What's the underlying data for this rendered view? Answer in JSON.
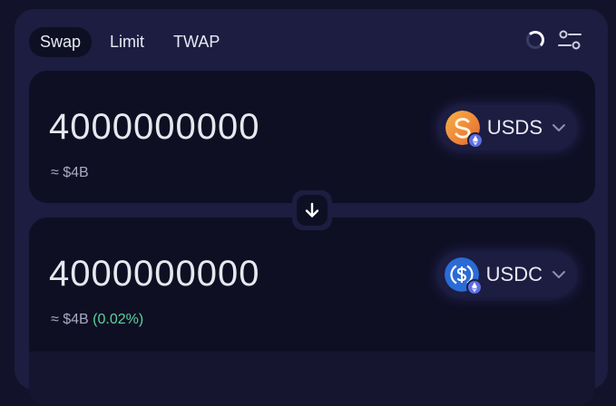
{
  "tabs": [
    {
      "label": "Swap",
      "active": true
    },
    {
      "label": "Limit",
      "active": false
    },
    {
      "label": "TWAP",
      "active": false
    }
  ],
  "sell": {
    "amount": "4000000000",
    "usd_value": "≈ $4B",
    "token": {
      "symbol": "USDS",
      "icon": "usds-token-icon",
      "network_icon": "ethereum-icon"
    }
  },
  "buy": {
    "amount": "4000000000",
    "usd_value": "≈ $4B",
    "price_impact": "(0.02%)",
    "token": {
      "symbol": "USDC",
      "icon": "usdc-token-icon",
      "network_icon": "ethereum-icon"
    }
  },
  "colors": {
    "background": "#12122a",
    "widget": "#1d1d42",
    "panel": "#0f0f24",
    "positive": "#5bd39a",
    "usds_orange": "#f29a3b",
    "usdc_blue": "#2a6bd6"
  }
}
